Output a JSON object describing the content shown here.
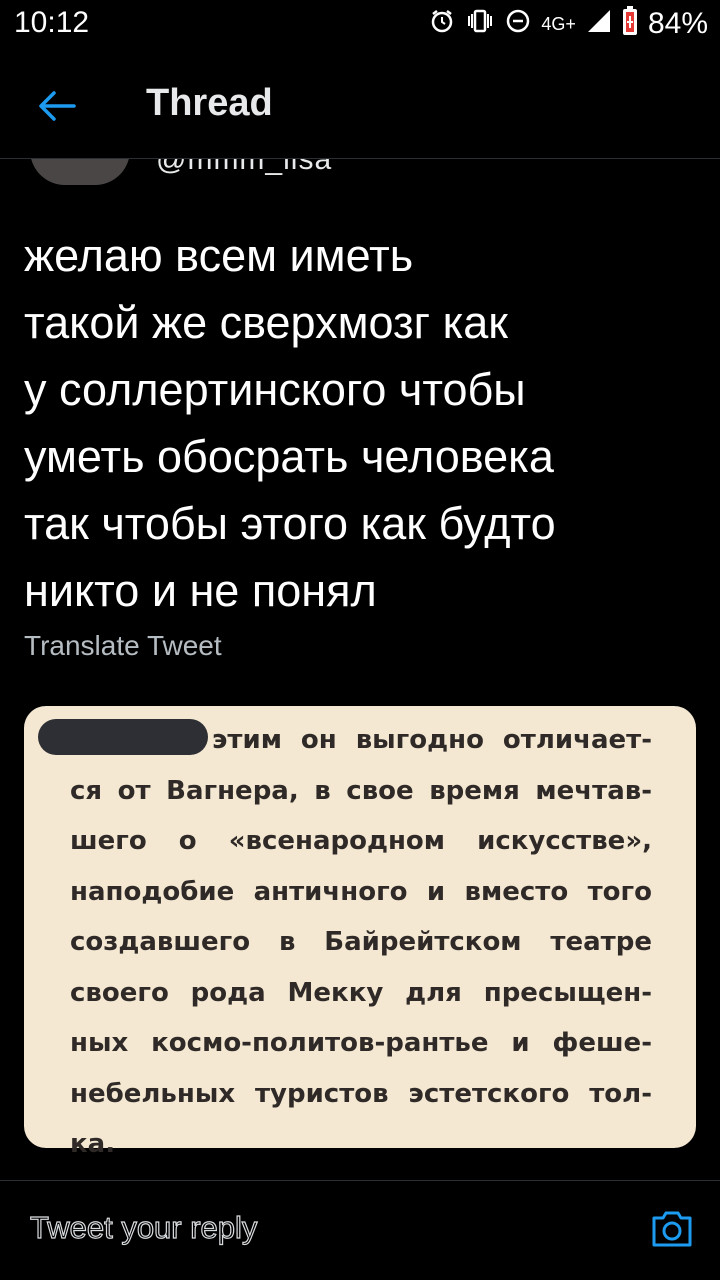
{
  "status_bar": {
    "time": "10:12",
    "network": "4G+",
    "battery": "84%"
  },
  "header": {
    "title": "Thread",
    "accent_color": "#1d9bf0"
  },
  "author": {
    "handle": "@mmm_lisa"
  },
  "tweet": {
    "lines": [
      "желаю всем иметь",
      "такой же сверхмозг как",
      "у соллертинского чтобы",
      "уметь обосрать человека",
      "так чтобы этого как будто",
      "никто и не понял"
    ],
    "translate_label": "Translate Tweet"
  },
  "media": {
    "background": "#f4e8d3",
    "lines": [
      "этим он выгодно отличает-",
      "ся от Вагнера, в свое время мечтав-",
      "шего о «всенародном искусстве»,",
      "наподобие античного и вместо того",
      "создавшего в Байрейтском театре",
      "своего рода Мекку для пресыщен-",
      "ных космо-политов-рантье и феше-",
      "небельных туристов эстетского тол-",
      "ка."
    ]
  },
  "reply": {
    "placeholder": "Tweet your reply",
    "camera_icon": "camera-icon"
  }
}
